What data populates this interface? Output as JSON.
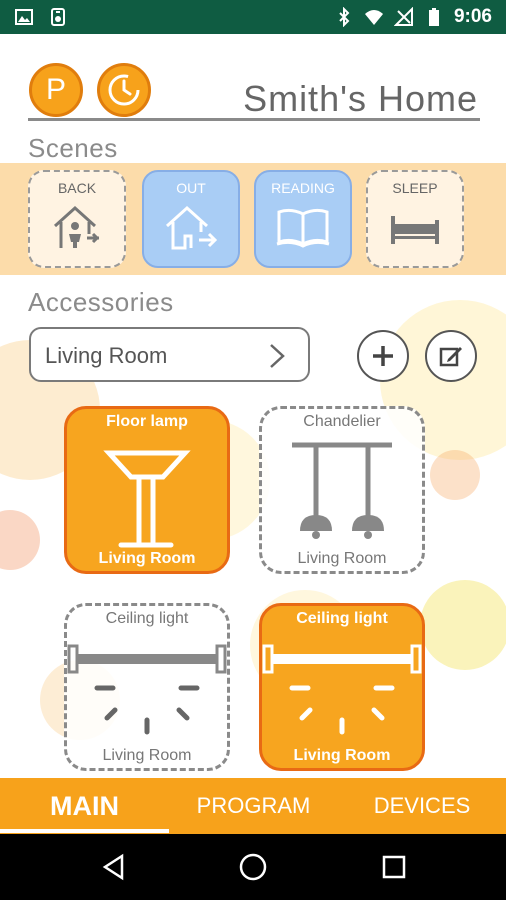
{
  "status_bar": {
    "time": "9:06",
    "left_icons": [
      "image-icon",
      "storage-icon"
    ],
    "right_icons": [
      "bluetooth-icon",
      "wifi-icon",
      "no-signal-icon",
      "battery-icon"
    ]
  },
  "header": {
    "p_button_label": "P",
    "timer_icon": "timer-icon",
    "title": "Smith's Home"
  },
  "scenes": {
    "title": "Scenes",
    "items": [
      {
        "label": "BACK",
        "icon": "home-person-icon",
        "active": false
      },
      {
        "label": "OUT",
        "icon": "house-exit-icon",
        "active": true
      },
      {
        "label": "READING",
        "icon": "book-icon",
        "active": true
      },
      {
        "label": "SLEEP",
        "icon": "bed-icon",
        "active": false
      }
    ]
  },
  "accessories": {
    "title": "Accessories",
    "room_select": {
      "value": "Living Room"
    },
    "add_icon": "plus-icon",
    "edit_icon": "edit-icon",
    "items": [
      {
        "name": "Floor lamp",
        "room": "Living Room",
        "icon": "floor-lamp-icon",
        "on": true
      },
      {
        "name": "Chandelier",
        "room": "Living Room",
        "icon": "chandelier-icon",
        "on": false
      },
      {
        "name": "Ceiling light",
        "room": "Living Room",
        "icon": "ceiling-light-icon",
        "on": false
      },
      {
        "name": "Ceiling light",
        "room": "Living Room",
        "icon": "ceiling-light-icon",
        "on": true
      }
    ]
  },
  "tabs": [
    {
      "label": "MAIN",
      "active": true
    },
    {
      "label": "PROGRAM",
      "active": false
    },
    {
      "label": "DEVICES",
      "active": false
    }
  ],
  "nav": [
    "back-icon",
    "home-icon",
    "recents-icon"
  ],
  "colors": {
    "accent": "#f7a21b",
    "accent_dark": "#e86a14",
    "scene_active": "#a9cdf5",
    "scenes_bg": "#fcdcaa",
    "status_bar": "#0f5c42"
  }
}
